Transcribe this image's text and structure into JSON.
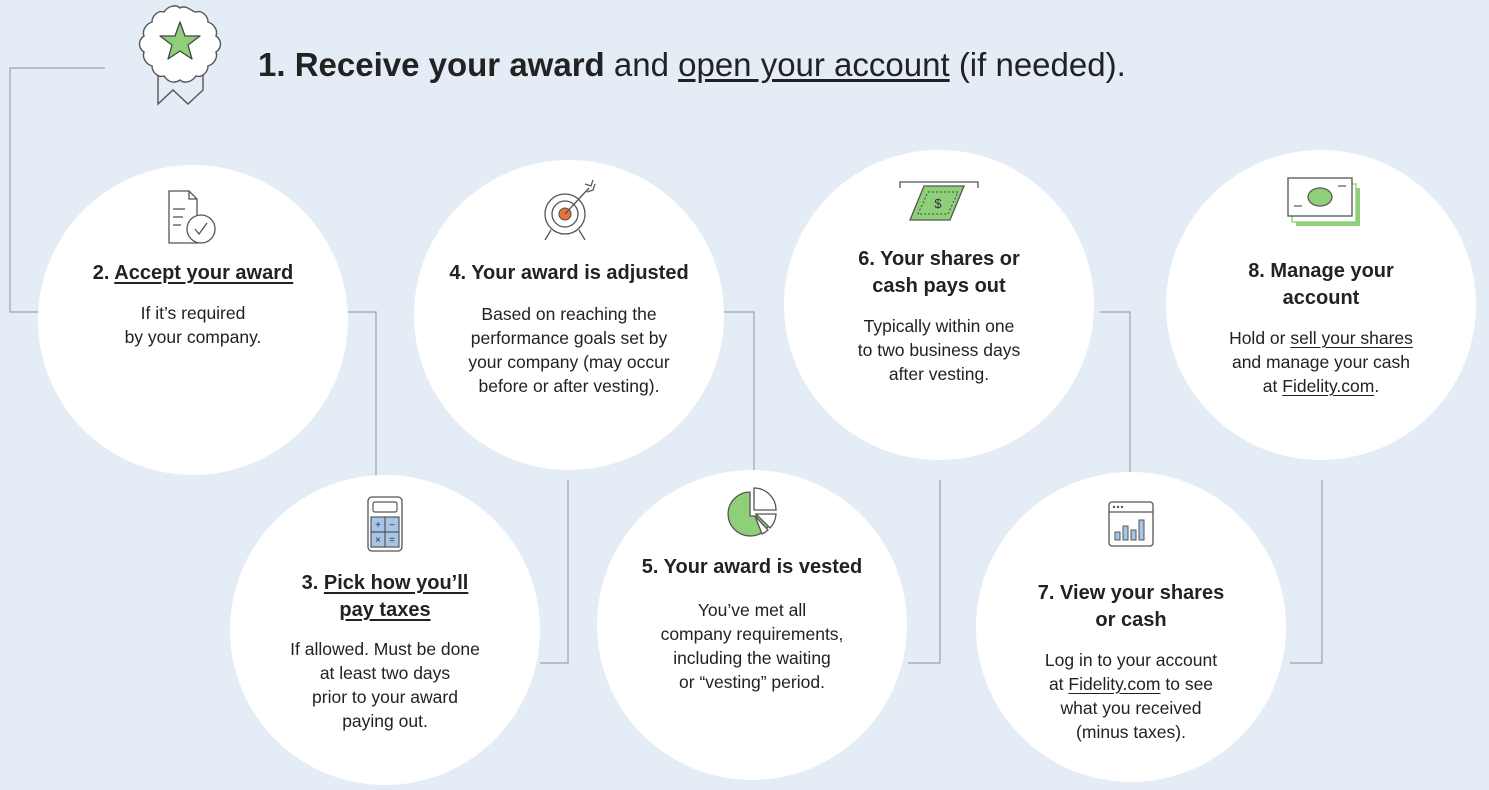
{
  "header": {
    "step_number": "1.",
    "bold_text": "Receive your award",
    "connector": "and",
    "link_text": "open your account",
    "suffix": "(if needed)."
  },
  "steps": [
    {
      "title_number": "2.",
      "title": "Accept your award",
      "body": [
        "If it’s required",
        "by your company."
      ]
    },
    {
      "title_number": "3.",
      "title_line1": "Pick how you’ll",
      "title_line2": "pay taxes",
      "body": [
        "If allowed. Must be done",
        "at least two days",
        "prior to your award",
        "paying out."
      ]
    },
    {
      "title": "4. Your award is adjusted",
      "body": [
        "Based on reaching the",
        "performance goals set by",
        "your company (may occur",
        "before or after vesting)."
      ]
    },
    {
      "title": "5. Your award is vested",
      "body": [
        "You’ve met all",
        "company requirements,",
        "including the waiting",
        "or “vesting” period."
      ]
    },
    {
      "title_line1": "6. Your shares or",
      "title_line2": "cash pays out",
      "body": [
        "Typically within one",
        "to two business days",
        "after vesting."
      ]
    },
    {
      "title_line1": "7. View your shares",
      "title_line2": "or cash",
      "body_line1": "Log in to your account",
      "body_line2_pre": "at",
      "body_line2_link": "Fidelity.com",
      "body_line2_post": "to see",
      "body_line3": "what you received",
      "body_line4": "(minus taxes)."
    },
    {
      "title_line1": "8. Manage your",
      "title_line2": "account",
      "body_line1_pre": "Hold or",
      "body_line1_link": "sell your shares",
      "body_line2": "and manage your cash",
      "body_line3_pre": "at",
      "body_line3_link": "Fidelity.com",
      "body_line3_post": "."
    }
  ],
  "colors": {
    "background": "#e4ecf6",
    "accent_green": "#8fcf7a",
    "icon_blue": "#a7c5e6",
    "line_gray": "#9aa3ad"
  },
  "icons": [
    "award-ribbon-icon",
    "document-clock-icon",
    "calculator-icon",
    "target-arrow-icon",
    "pie-chart-icon",
    "cash-dispense-icon",
    "browser-bar-chart-icon",
    "cash-bills-icon"
  ]
}
